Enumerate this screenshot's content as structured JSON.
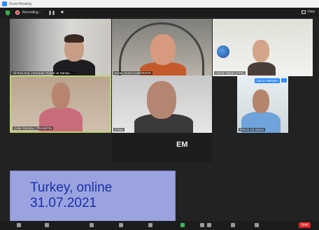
{
  "window": {
    "title": "Zoom Meeting"
  },
  "topbar": {
    "recording_label": "Recording...",
    "pause_icon": "pause-icon",
    "stop_icon": "stop-icon",
    "view_label": "View"
  },
  "participants": [
    {
      "name": "Ali Riza KUL | Erzurum Ticaret ve Sanayi ..."
    },
    {
      "name": "Erkan OLDUCU/BÜROYK"
    },
    {
      "name": "Hande Taştan (ATO)"
    },
    {
      "name": "Celal GÜLBAL | TRABZON"
    },
    {
      "name": "Erhan"
    },
    {
      "name": "POCO X3 Ahmet"
    },
    {
      "name": ""
    }
  ],
  "tile_actions": {
    "add_label": "Add to Website",
    "more_label": "..."
  },
  "logo_partial": "EM",
  "caption": {
    "line1": "Turkey, online",
    "line2": "31.07.2021"
  },
  "toolbar": {
    "end_label": "End"
  },
  "colors": {
    "caption_bg": "#9aa3e0",
    "caption_text": "#1c2fa6",
    "accent": "#2d8cff",
    "active_speaker": "#b9d56b",
    "end": "#e02828"
  }
}
